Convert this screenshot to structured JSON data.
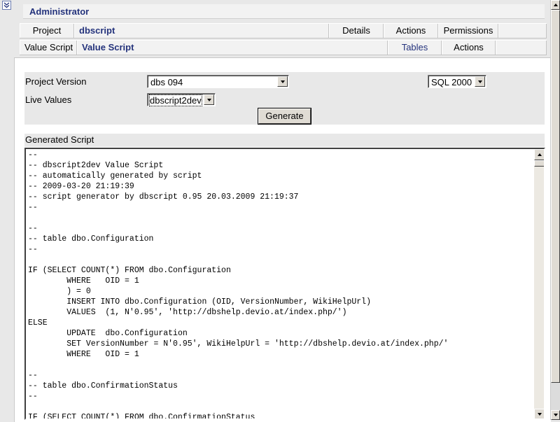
{
  "header": {
    "title": "Administrator"
  },
  "project_bar": {
    "label": "Project",
    "name": "dbscript",
    "tabs": [
      "Details",
      "Actions",
      "Permissions"
    ]
  },
  "script_bar": {
    "label": "Value Script",
    "name": "Value Script",
    "tabs": [
      "Tables",
      "Actions"
    ]
  },
  "form": {
    "project_version_label": "Project Version",
    "project_version_value": "dbs 094",
    "db_value": "SQL 2000",
    "live_values_label": "Live Values",
    "live_values_value": "dbscript2dev",
    "generate_label": "Generate"
  },
  "output": {
    "label": "Generated Script",
    "script": "--\n-- dbscript2dev Value Script\n-- automatically generated by script\n-- 2009-03-20 21:19:39\n-- script generator by dbscript 0.95 20.03.2009 21:19:37\n--\n\n--\n-- table dbo.Configuration\n--\n\nIF (SELECT COUNT(*) FROM dbo.Configuration\n\tWHERE   OID = 1\n\t) = 0\n\tINSERT INTO dbo.Configuration (OID, VersionNumber, WikiHelpUrl)\n\tVALUES  (1, N'0.95', 'http://dbshelp.devio.at/index.php/')\nELSE\n\tUPDATE  dbo.Configuration\n\tSET VersionNumber = N'0.95', WikiHelpUrl = 'http://dbshelp.devio.at/index.php/'\n\tWHERE   OID = 1\n\n--\n-- table dbo.ConfirmationStatus\n--\n\nIF (SELECT COUNT(*) FROM dbo.ConfirmationStatus"
  },
  "icons": {
    "collapse": "double-chevron-down-icon",
    "scroll_up": "arrow-up-icon",
    "scroll_down": "arrow-down-icon",
    "dropdown": "arrow-down-icon"
  },
  "colors": {
    "title_text": "#24337c",
    "background": "#e8e8e8",
    "panel": "#ffffff"
  }
}
